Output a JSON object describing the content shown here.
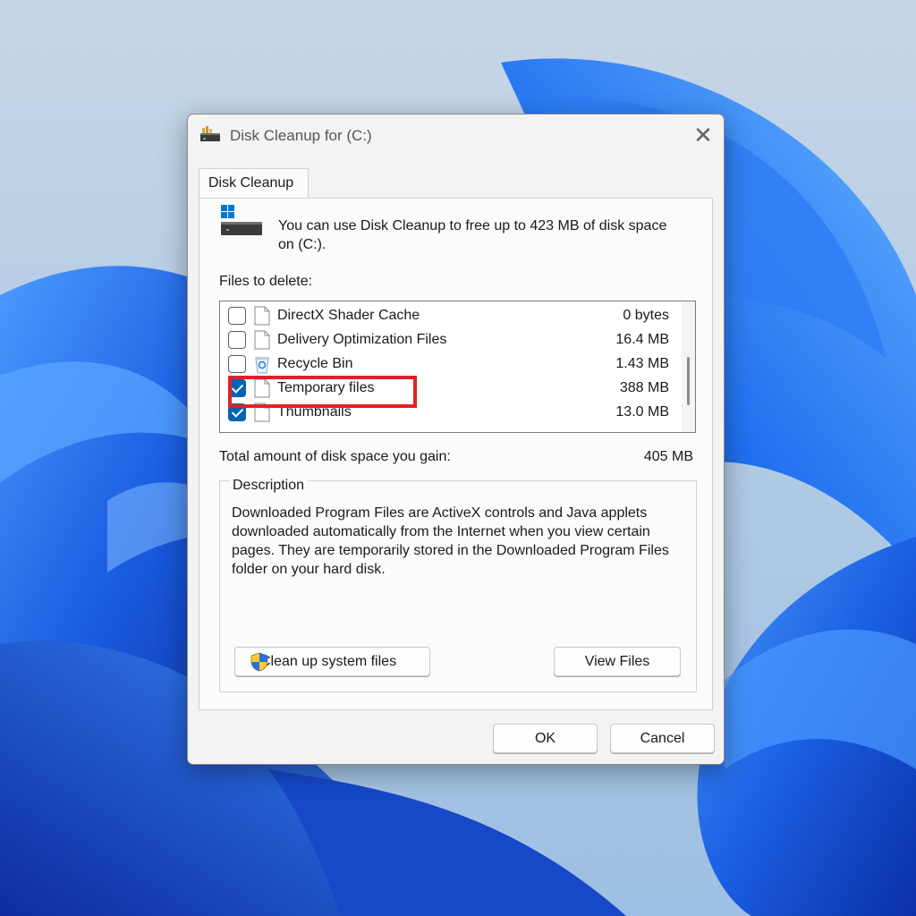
{
  "window": {
    "title": "Disk Cleanup for  (C:)",
    "close_glyph": "✕"
  },
  "tabs": [
    {
      "label": "Disk Cleanup",
      "selected": true
    }
  ],
  "intro": {
    "icon": "drive-icon",
    "text": "You can use Disk Cleanup to free up to 423 MB of disk space on  (C:)."
  },
  "files_to_delete": {
    "label": "Files to delete:",
    "items": [
      {
        "name": "DirectX Shader Cache",
        "size": "0 bytes",
        "checked": false,
        "icon": "file-icon"
      },
      {
        "name": "Delivery Optimization Files",
        "size": "16.4 MB",
        "checked": false,
        "icon": "file-icon"
      },
      {
        "name": "Recycle Bin",
        "size": "1.43 MB",
        "checked": false,
        "icon": "recycle-bin-icon"
      },
      {
        "name": "Temporary files",
        "size": "388 MB",
        "checked": true,
        "icon": "file-icon",
        "highlighted": true
      },
      {
        "name": "Thumbnails",
        "size": "13.0 MB",
        "checked": true,
        "icon": "file-icon"
      }
    ]
  },
  "total": {
    "label": "Total amount of disk space you gain:",
    "value": "405 MB"
  },
  "description": {
    "legend": "Description",
    "text": "Downloaded Program Files are ActiveX controls and Java applets downloaded automatically from the Internet when you view certain pages. They are temporarily stored in the Downloaded Program Files folder on your hard disk."
  },
  "buttons": {
    "cleanup_system": "Clean up system files",
    "view_files": "View Files",
    "ok": "OK",
    "cancel": "Cancel"
  },
  "colors": {
    "accent": "#0063b1",
    "highlight": "#e2202a",
    "wallpaper_bg": "#a9c4df",
    "wallpaper_bloom": "#1a5fe0"
  }
}
